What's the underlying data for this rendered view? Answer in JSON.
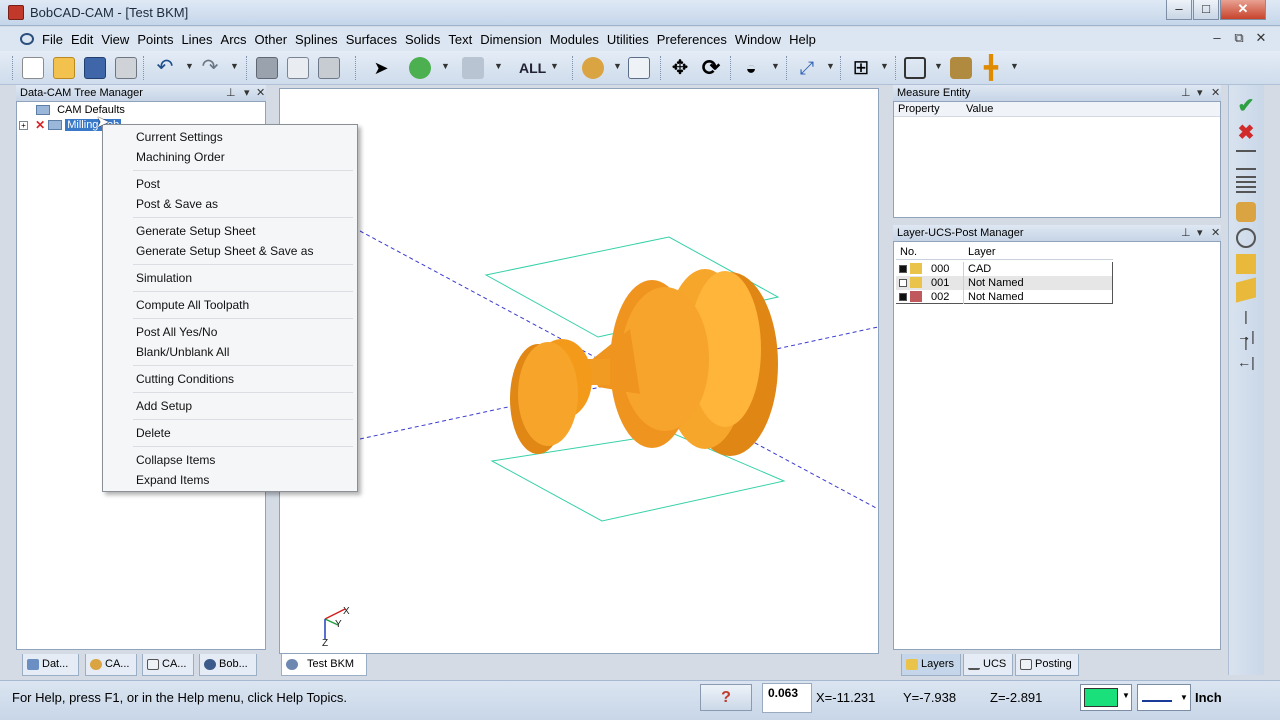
{
  "window": {
    "title": "BobCAD-CAM - [Test BKM]",
    "controls": [
      "–",
      "□",
      "✕"
    ]
  },
  "menubar": {
    "items": [
      "File",
      "Edit",
      "View",
      "Points",
      "Lines",
      "Arcs",
      "Other",
      "Splines",
      "Surfaces",
      "Solids",
      "Text",
      "Dimension",
      "Modules",
      "Utilities",
      "Preferences",
      "Window",
      "Help"
    ],
    "mdi_controls": [
      "–",
      "⧉",
      "✕"
    ]
  },
  "toolbar": {
    "selection_filter": "ALL"
  },
  "tree_panel": {
    "title": "Data-CAM Tree Manager",
    "items": [
      "CAM Defaults",
      "Milling Job"
    ]
  },
  "context_menu": {
    "items": [
      "Current Settings",
      "Machining Order",
      "Post",
      "Post & Save as",
      "Generate Setup Sheet",
      "Generate Setup Sheet & Save as",
      "Simulation",
      "Compute All Toolpath",
      "Post All Yes/No",
      "Blank/Unblank All",
      "Cutting Conditions",
      "Add Setup",
      "Delete",
      "Collapse Items",
      "Expand Items"
    ]
  },
  "left_tabs": [
    "Dat...",
    "CA...",
    "CA...",
    "Bob..."
  ],
  "viewport": {
    "tab_label": "Test BKM",
    "axis_labels": {
      "x": "X",
      "y": "Y",
      "z": "Z"
    }
  },
  "measure_panel": {
    "title": "Measure Entity",
    "columns": [
      "Property",
      "Value"
    ]
  },
  "layer_panel": {
    "title": "Layer-UCS-Post Manager",
    "columns": [
      "No.",
      "Layer"
    ],
    "rows": [
      {
        "no": "000",
        "name": "CAD"
      },
      {
        "no": "001",
        "name": "Not Named"
      },
      {
        "no": "002",
        "name": "Not Named"
      }
    ],
    "tabs": [
      "Layers",
      "UCS",
      "Posting"
    ]
  },
  "statusbar": {
    "help_text": "For Help, press F1, or in the Help menu, click Help Topics.",
    "step_value": "0.063",
    "x": "X=-11.231",
    "y": "Y=-7.938",
    "z": "Z=-2.891",
    "units": "Inch"
  },
  "colors": {
    "part": "#f39a1a",
    "layer_color": "#19e07a",
    "accent": "#3a78c8"
  }
}
